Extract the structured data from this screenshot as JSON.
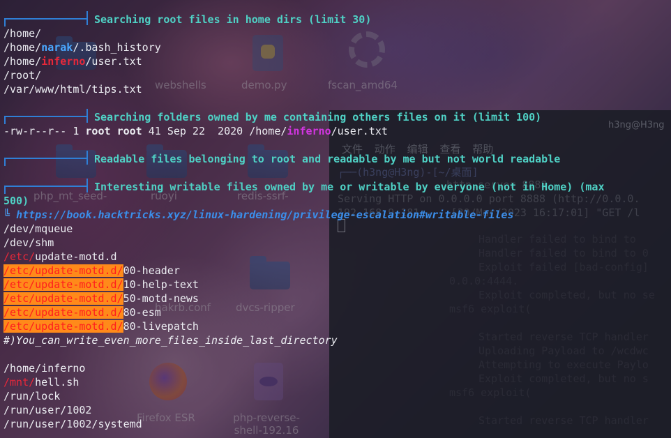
{
  "desktop": {
    "icons": [
      {
        "label": "webshells",
        "icon": "folder-icon"
      },
      {
        "label": "demo.py",
        "icon": "python-file-icon"
      },
      {
        "label": "fscan_amd64",
        "icon": "gear-executable-icon"
      },
      {
        "label": "php_mt_seed-",
        "icon": "folder-icon"
      },
      {
        "label": "ruoyi",
        "icon": "folder-icon"
      },
      {
        "label": "redis-ssrf-",
        "icon": "folder-icon"
      },
      {
        "label": "hakrb.conf",
        "icon": "config-file-icon"
      },
      {
        "label": "dvcs-ripper",
        "icon": "folder-icon"
      },
      {
        "label": "Firefox ESR",
        "icon": "firefox-icon"
      },
      {
        "label": "php-reverse-shell-192.16",
        "icon": "php-file-icon"
      }
    ]
  },
  "bg_terminal": {
    "title": "h3ng@H3ng",
    "menu": [
      "文件",
      "动作",
      "编辑",
      "查看",
      "帮助"
    ],
    "prompt_user": "(h3ng@H3ng)",
    "prompt_dir": "~/桌面",
    "lines": [
      "http.server 8888",
      "Serving HTTP on 0.0.0.0 port 8888 (http://0.0.0.",
      "192.168.9.181 - - [30/Mar/2023 16:17:01] \"GET /l"
    ],
    "faded_lines": [
      "Handler failed to bind to",
      "Handler failed to bind to 0",
      "Exploit failed [bad-config]",
      "0.0.0:4444.",
      "Exploit completed, but no se",
      "msf6 exploit(",
      "Started reverse TCP handler",
      "Uploading Payload to /wcdwc",
      "Attempting to execute Paylo",
      "Exploit completed, but no s",
      "msf6 exploit(",
      "Started reverse TCP handler"
    ]
  },
  "terminal": {
    "sections": {
      "s1_title": "Searching root files in home dirs (limit 30)",
      "s2_title": "Searching folders owned by me containing others files on it (limit 100)",
      "s3_title": "Readable files belonging to root and readable by me but not world readable",
      "s4_title": "Interesting writable files owned by me or writable by everyone (not in Home) (max",
      "s4_title_cont": "500)"
    },
    "root_files": {
      "l1": "/home/",
      "l2_pre": "/home/",
      "l2_user": "narak",
      "l2_post": "/.bash_history",
      "l3_pre": "/home/",
      "l3_user": "inferno",
      "l3_post": "/user.txt",
      "l4": "/root/",
      "l5": "/var/www/html/tips.txt"
    },
    "owned": {
      "perms": "-rw-r--r--",
      "links": "1",
      "owner": "root",
      "group": "root",
      "size": "41",
      "date": "Sep 22  2020",
      "path_pre": "/home/",
      "path_user": "inferno",
      "path_post": "/user.txt"
    },
    "link": {
      "prefix": "╚",
      "url": "https://book.hacktricks.xyz/linux-hardening/privilege-escalation#writable-files"
    },
    "writable": {
      "l1": "/dev/mqueue",
      "l2": "/dev/shm",
      "l3_red": "/etc/",
      "l3_rest": "update-motd.d",
      "motd_dir": "/etc/update-motd.d/",
      "motd_files": [
        "00-header",
        "10-help-text",
        "50-motd-news",
        "80-esm",
        "80-livepatch"
      ],
      "note": "#)You_can_write_even_more_files_inside_last_directory",
      "l9": "/home/inferno",
      "l10_red": "/mnt/",
      "l10_rest": "hell.sh",
      "l11": "/run/lock",
      "l12": "/run/user/1002",
      "l13": "/run/user/1002/systemd"
    }
  }
}
